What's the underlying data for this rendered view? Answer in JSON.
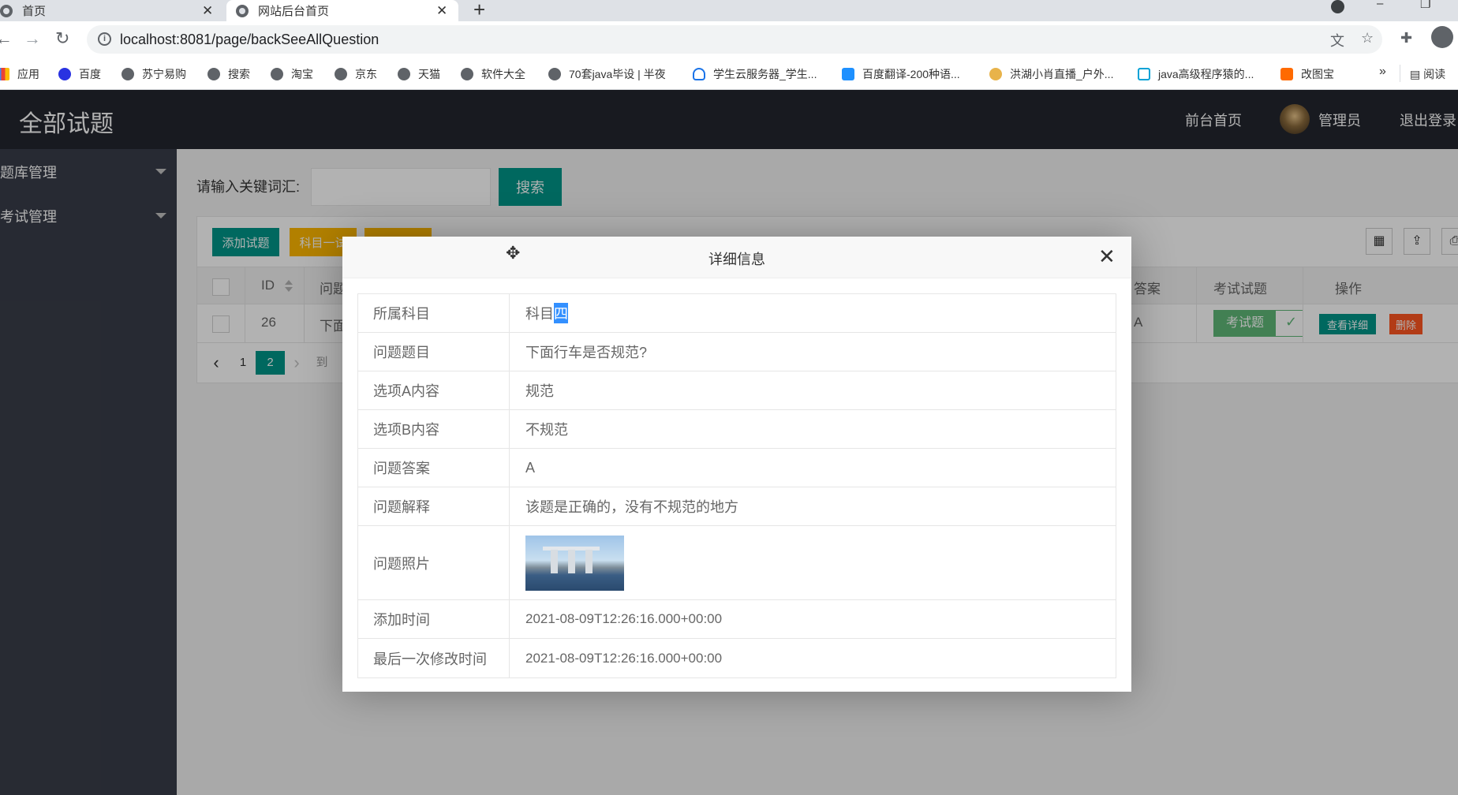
{
  "browser": {
    "tabs": [
      {
        "title": "首页"
      },
      {
        "title": "网站后台首页"
      }
    ],
    "url": "localhost:8081/page/backSeeAllQuestion",
    "bookmarks": [
      {
        "label": "应用",
        "icon": "apps-icon"
      },
      {
        "label": "百度",
        "icon": "baidu-icon"
      },
      {
        "label": "苏宁易购",
        "icon": "globe-icon"
      },
      {
        "label": "搜索",
        "icon": "globe-icon"
      },
      {
        "label": "淘宝",
        "icon": "globe-icon"
      },
      {
        "label": "京东",
        "icon": "globe-icon"
      },
      {
        "label": "天猫",
        "icon": "globe-icon"
      },
      {
        "label": "软件大全",
        "icon": "globe-icon"
      },
      {
        "label": "70套java毕设 | 半夜",
        "icon": "globe-icon"
      },
      {
        "label": "学生云服务器_学生...",
        "icon": "cloud-icon"
      },
      {
        "label": "百度翻译-200种语...",
        "icon": "translate-icon"
      },
      {
        "label": "洪湖小肖直播_户外...",
        "icon": "bookmark-icon"
      },
      {
        "label": "java高级程序猿的...",
        "icon": "bilibili-icon"
      },
      {
        "label": "改图宝",
        "icon": "app-icon"
      }
    ],
    "bookmarks_more": "»",
    "reading_list": "阅读"
  },
  "header": {
    "title": "全部试题",
    "nav_home": "前台首页",
    "user": "管理员",
    "logout": "退出登录"
  },
  "sidebar": {
    "items": [
      {
        "label": "题库管理"
      },
      {
        "label": "考试管理"
      }
    ]
  },
  "search": {
    "label": "请输入关键词汇:",
    "placeholder": "",
    "button": "搜索"
  },
  "toolbar": {
    "add": "添加试题",
    "subject1": "科目一试"
  },
  "table": {
    "headers": {
      "id": "ID",
      "question": "问题",
      "answer": "答案",
      "exam": "考试试题",
      "ops": "操作"
    },
    "rows": [
      {
        "id": "26",
        "question": "下面",
        "answer": "A",
        "exam_switch": "考试题",
        "exam_on": true,
        "detail_btn": "查看详细",
        "delete_btn": "删除"
      }
    ]
  },
  "pagination": {
    "prev": "‹",
    "pages": [
      "1",
      "2"
    ],
    "current": "2",
    "next": "›",
    "goto": "到"
  },
  "modal": {
    "title": "详细信息",
    "fields": [
      {
        "key": "所属科目",
        "value_prefix": "科目",
        "value_selected": "四"
      },
      {
        "key": "问题题目",
        "value": "下面行车是否规范?"
      },
      {
        "key": "选项A内容",
        "value": "规范"
      },
      {
        "key": "选项B内容",
        "value": "不规范"
      },
      {
        "key": "问题答案",
        "value": "A"
      },
      {
        "key": "问题解释",
        "value": "该题是正确的，没有不规范的地方"
      },
      {
        "key": "问题照片",
        "value": ""
      },
      {
        "key": "添加时间",
        "value": "2021-08-09T12:26:16.000+00:00"
      },
      {
        "key": "最后一次修改时间",
        "value": "2021-08-09T12:26:16.000+00:00"
      }
    ]
  },
  "colors": {
    "header_bg": "#23262e",
    "sidebar_bg": "#393d49",
    "primary": "#009688",
    "warn": "#ffb800",
    "danger": "#ff5722",
    "switch_on": "#5fb878"
  }
}
